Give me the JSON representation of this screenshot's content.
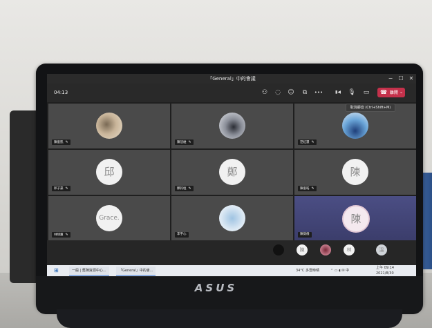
{
  "window": {
    "title": "「General」中的會議",
    "controls": {
      "minimize": "−",
      "maximize": "☐",
      "close": "✕"
    }
  },
  "toolbar": {
    "elapsed_time": "04:13",
    "icons": [
      "people-icon",
      "chat-icon",
      "reactions-icon",
      "share-screen-icon",
      "more-icon",
      "camera-icon",
      "mic-muted-icon",
      "share-tray-icon"
    ],
    "icon_glyphs": [
      "⚇",
      "◌",
      "☺",
      "⧉",
      "•••",
      "▮◀",
      "🎙",
      "▭"
    ],
    "leave_label": "離開",
    "leave_phone": "☎",
    "leave_chevron": "⌄"
  },
  "tooltip": "取消靜音 (Ctrl+Shift+M)",
  "participants": [
    {
      "name": "陳俊凱",
      "avatar": "",
      "avatar_style": "photo1",
      "mic": "✎"
    },
    {
      "name": "陳冠維",
      "avatar": "",
      "avatar_style": "photo2",
      "mic": "✎"
    },
    {
      "name": "范紅慧",
      "avatar": "",
      "avatar_style": "photo3",
      "mic": "✎"
    },
    {
      "name": "邱子豪",
      "avatar": "邱",
      "avatar_style": "",
      "mic": "✎"
    },
    {
      "name": "鄭鈞桓",
      "avatar": "鄭",
      "avatar_style": "",
      "mic": "✎"
    },
    {
      "name": "陳俊皓",
      "avatar": "陳",
      "avatar_style": "",
      "mic": "✎"
    },
    {
      "name": "林晴蕙",
      "avatar": "Grace.",
      "avatar_style": "small-text",
      "mic": "✎"
    },
    {
      "name": "李宇心",
      "avatar": "",
      "avatar_style": "photo4",
      "mic": ""
    },
    {
      "name": "陳薇儀",
      "avatar": "陳",
      "avatar_style": "ring",
      "mic": ""
    }
  ],
  "overflow_strip": {
    "avatars": [
      "",
      "陳",
      "",
      "林",
      "溫"
    ]
  },
  "taskbar": {
    "start_icon": "⊞",
    "tasks": [
      "一般 | 舊陳資源中心...",
      "「General」中的會..."
    ],
    "weather": "34°C 多雲時晴",
    "tray_icons": "⌃ ▭ ◖ ✉ 中",
    "clock_time": "上午 09:14",
    "clock_date": "2021/8/30"
  },
  "hardware": {
    "brand": "ASUS"
  }
}
